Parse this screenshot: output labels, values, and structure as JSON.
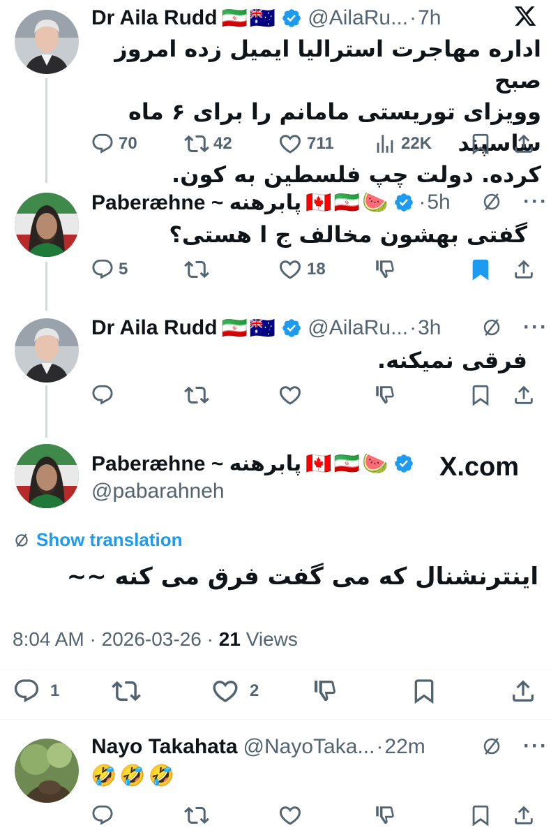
{
  "tweets": [
    {
      "author": "Dr Aila Rudd",
      "flags": [
        "🇮🇷",
        "🇦🇺"
      ],
      "handle": "@AilaRu...",
      "time": "7h",
      "text": "اداره مهاجرت استرالیا ایمیل زده امروز صبح وویزای توریستی مامانم را برای ۶ ماه ساسپند کرده. دولت چپ فلسطین به کون.",
      "lines": [
        "اداره مهاجرت استرالیا ایمیل زده امروز صبح",
        "وویزای توریستی مامانم را برای ۶ ماه ساسپند",
        "کرده. دولت چپ فلسطین به کون."
      ],
      "replies": "70",
      "reposts": "42",
      "likes": "711",
      "views": "22K"
    },
    {
      "author": "Paberæhne ~ پابرهنه",
      "flags": [
        "🇨🇦",
        "🇮🇷",
        "🍉"
      ],
      "handle": "",
      "time": "5h",
      "text": "گفتی بهشون مخالف ج ا هستی؟",
      "replies": "5",
      "reposts": "",
      "likes": "18"
    },
    {
      "author": "Dr Aila Rudd",
      "flags": [
        "🇮🇷",
        "🇦🇺"
      ],
      "handle": "@AilaRu...",
      "time": "3h",
      "text": "فرقی نمیکنه."
    }
  ],
  "main_tweet": {
    "author": "Paberæhne ~ پابرهنه",
    "flags": [
      "🇨🇦",
      "🇮🇷",
      "🍉"
    ],
    "handle": "@pabarahneh",
    "source_label": "X.com",
    "show_translation": "Show translation",
    "text": "اینترنشنال که می گفت فرق می کنه ~~",
    "time": "8:04 AM",
    "date": "2026-03-26",
    "views_count": "21",
    "views_label": "Views",
    "replies": "1",
    "likes": "2"
  },
  "reply": {
    "author": "Nayo Takahata",
    "handle": "@NayoTaka...",
    "time": "22m",
    "text": "🤣🤣🤣"
  },
  "separator": "·",
  "colors": {
    "text": "#0f1419",
    "secondary": "#536471",
    "accent": "#1d9bf0",
    "divider": "#eff3f4",
    "thread_line": "#cfd9de"
  },
  "icons": [
    "x-logo-icon",
    "verified-badge-icon",
    "reply-icon",
    "repost-icon",
    "like-icon",
    "views-icon",
    "bookmark-icon",
    "share-icon",
    "dislike-icon",
    "grok-icon",
    "more-icon",
    "translate-icon"
  ]
}
